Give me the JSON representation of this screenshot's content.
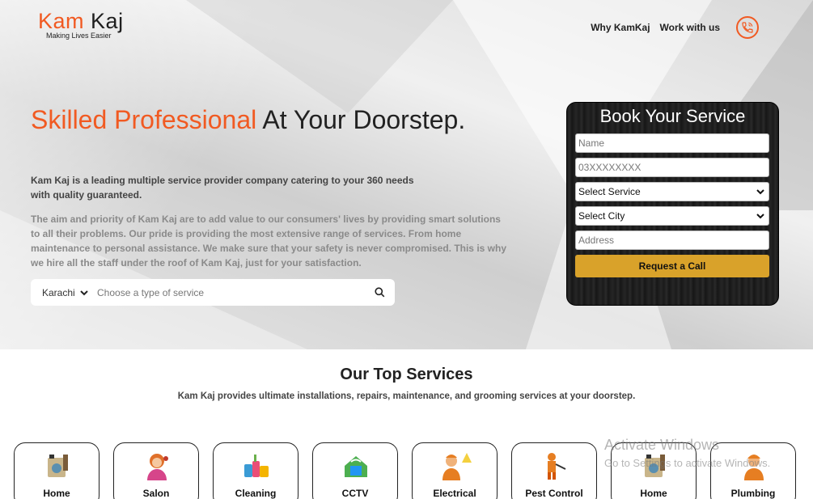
{
  "brand": {
    "name_part1": "Kam",
    "name_part2": "Kaj",
    "tagline": "Making Lives Easier"
  },
  "nav": {
    "links": [
      "Why KamKaj",
      "Work with us"
    ]
  },
  "hero": {
    "headline_accent": "Skilled Professional",
    "headline_rest": "At Your Doorstep.",
    "lead": "Kam Kaj is a leading multiple service provider company catering to your 360 needs with quality guaranteed.",
    "description": "The aim and priority of Kam Kaj are to add value to our consumers' lives by providing smart solutions to all their problems. Our pride is providing the most extensive range of services. From home maintenance to personal assistance. We make sure that your safety is never compromised. This is why we hire all the staff under the roof of Kam Kaj, just for your satisfaction.",
    "search": {
      "city": "Karachi",
      "placeholder": "Choose a type of service"
    }
  },
  "booking": {
    "title": "Book Your Service",
    "name_placeholder": "Name",
    "phone_placeholder": "03XXXXXXXX",
    "service_select": "Select Service",
    "city_select": "Select City",
    "address_placeholder": "Address",
    "submit_label": "Request a Call"
  },
  "services": {
    "title": "Our Top Services",
    "subtitle": "Kam Kaj provides ultimate installations, repairs, maintenance, and grooming services at your doorstep.",
    "items": [
      {
        "label": "Home",
        "icon": "appliance-repair-icon"
      },
      {
        "label": "Salon",
        "icon": "salon-icon"
      },
      {
        "label": "Cleaning",
        "icon": "cleaning-icon"
      },
      {
        "label": "CCTV",
        "icon": "cctv-icon"
      },
      {
        "label": "Electrical",
        "icon": "electrician-icon"
      },
      {
        "label": "Pest Control",
        "icon": "pest-control-icon"
      },
      {
        "label": "Home",
        "icon": "appliance-repair-icon"
      },
      {
        "label": "Plumbing",
        "icon": "plumber-icon"
      }
    ]
  },
  "watermark": {
    "line1": "Activate Windows",
    "line2": "Go to Settings to activate Windows."
  },
  "colors": {
    "accent": "#f15a22",
    "button": "#d9a22a",
    "panel": "#1c1c1c"
  }
}
